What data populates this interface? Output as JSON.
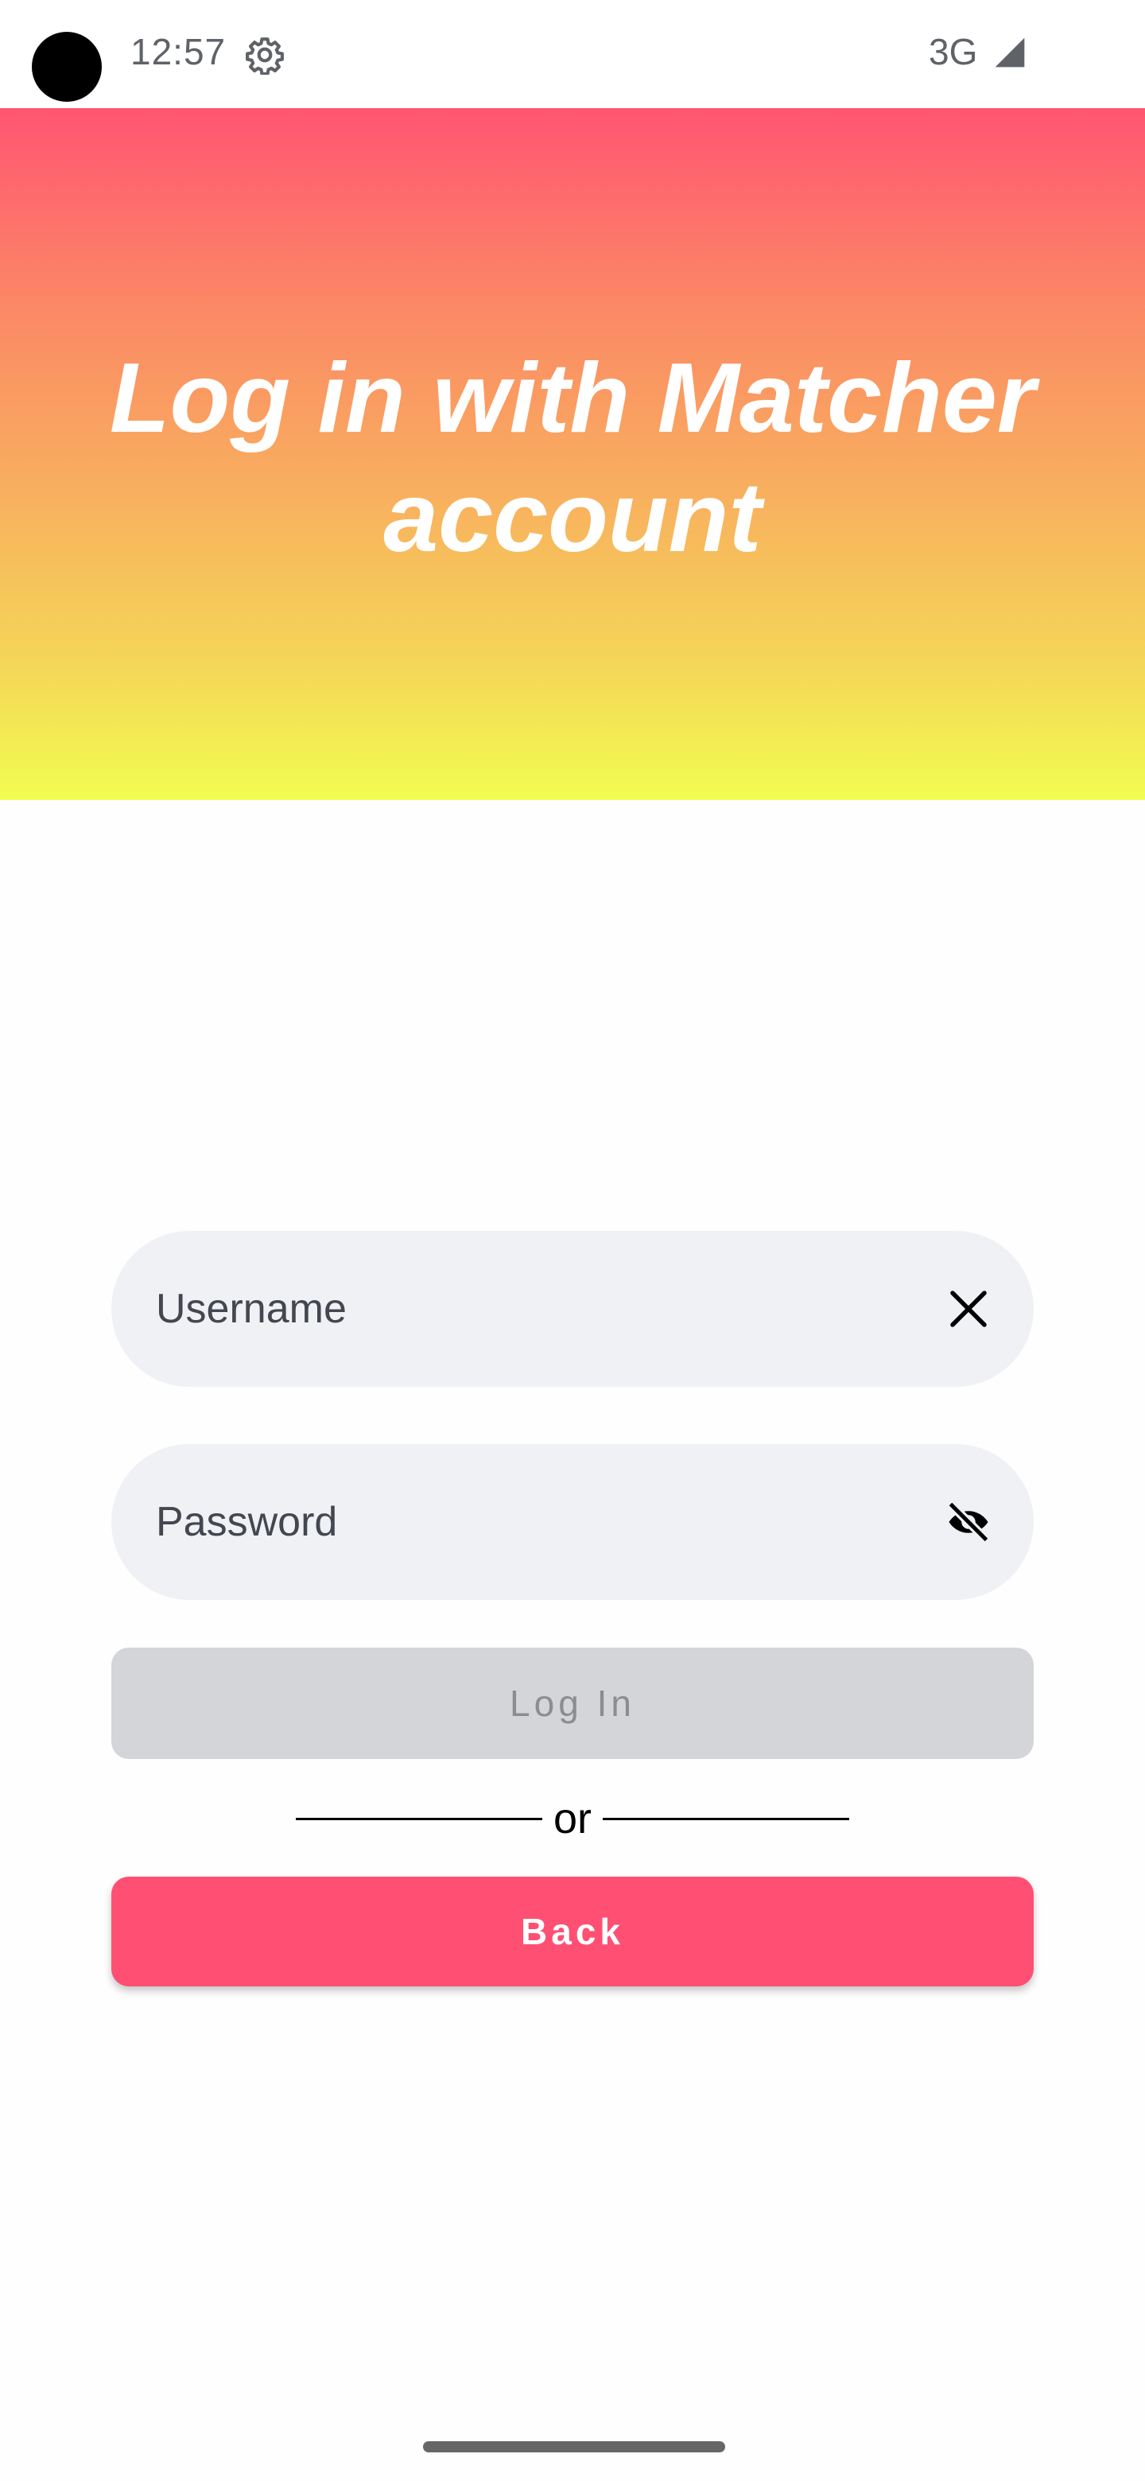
{
  "status_bar": {
    "time": "12:57",
    "network": "3G",
    "icons": [
      "settings-gear-icon",
      "cellular-signal-icon"
    ]
  },
  "header": {
    "title_line1": "Log in with Matcher",
    "title_line2": "account"
  },
  "form": {
    "username_placeholder": "Username",
    "password_placeholder": "Password",
    "username_icon": "clear-icon",
    "password_icon": "visibility-off-icon"
  },
  "actions": {
    "login_label": "Log In",
    "divider_text": "or",
    "back_label": "Back"
  },
  "colors": {
    "gradient_top": "#ff5572",
    "gradient_bottom": "#f2fd50",
    "back_button": "#ff4f73",
    "login_button_disabled": "#d4d5d9",
    "field_background": "#f0f1f5"
  }
}
